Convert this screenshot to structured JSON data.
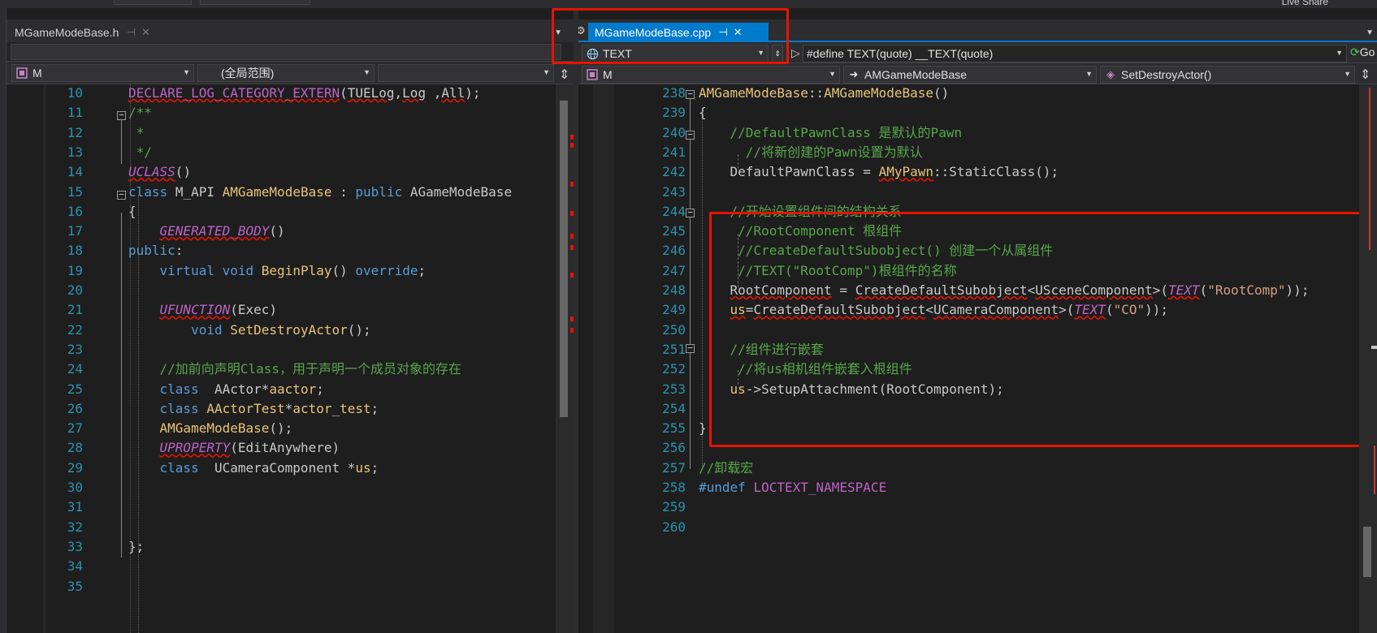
{
  "left_tab": {
    "label": "MGameModeBase.h",
    "pin": "⊣",
    "close": "✕"
  },
  "right_tab": {
    "label": "MGameModeBase.cpp",
    "pin": "⊣",
    "close": "✕"
  },
  "left_nav": {
    "project": "M",
    "scope": "(全局范围)",
    "member": ""
  },
  "right_macro_bar": {
    "symbol": "TEXT",
    "definition": "#define TEXT(quote) __TEXT(quote)",
    "go": "Go"
  },
  "right_nav": {
    "project": "M",
    "class": "AMGameModeBase",
    "member": "SetDestroyActor()"
  },
  "toolbar": {
    "live_share": "Live Share"
  },
  "left_code": [
    {
      "n": "10",
      "text": "DECLARE_LOG_CATEGORY_EXTERN(TUELog,Log ,All);"
    },
    {
      "n": "11",
      "text": "/**"
    },
    {
      "n": "12",
      "text": " *"
    },
    {
      "n": "13",
      "text": " */"
    },
    {
      "n": "14",
      "text": "UCLASS()"
    },
    {
      "n": "15",
      "text": "class M_API AMGameModeBase : public AGameModeBase"
    },
    {
      "n": "16",
      "text": "{"
    },
    {
      "n": "17",
      "text": "    GENERATED_BODY()"
    },
    {
      "n": "18",
      "text": "public:"
    },
    {
      "n": "19",
      "text": "    virtual void BeginPlay() override;"
    },
    {
      "n": "20",
      "text": ""
    },
    {
      "n": "21",
      "text": "    UFUNCTION(Exec)"
    },
    {
      "n": "22",
      "text": "        void SetDestroyActor();"
    },
    {
      "n": "23",
      "text": ""
    },
    {
      "n": "24",
      "text": "    //加前向声明Class，用于声明一个成员对象的存在"
    },
    {
      "n": "25",
      "text": "    class  AActor*aactor;"
    },
    {
      "n": "26",
      "text": "    class AActorTest*actor_test;"
    },
    {
      "n": "27",
      "text": "    AMGameModeBase();"
    },
    {
      "n": "28",
      "text": "    UPROPERTY(EditAnywhere)"
    },
    {
      "n": "29",
      "text": "    class  UCameraComponent *us;"
    },
    {
      "n": "30",
      "text": ""
    },
    {
      "n": "31",
      "text": ""
    },
    {
      "n": "32",
      "text": ""
    },
    {
      "n": "33",
      "text": "};"
    },
    {
      "n": "34",
      "text": ""
    },
    {
      "n": "35",
      "text": ""
    }
  ],
  "right_code": [
    {
      "n": "238",
      "text": "AMGameModeBase::AMGameModeBase()"
    },
    {
      "n": "239",
      "text": "{"
    },
    {
      "n": "240",
      "text": "    //DefaultPawnClass 是默认的Pawn"
    },
    {
      "n": "241",
      "text": "      //将新创建的Pawn设置为默认"
    },
    {
      "n": "242",
      "text": "    DefaultPawnClass = AMyPawn::StaticClass();"
    },
    {
      "n": "243",
      "text": ""
    },
    {
      "n": "244",
      "text": "    //开始设置组件间的结构关系"
    },
    {
      "n": "245",
      "text": "     //RootComponent 根组件"
    },
    {
      "n": "246",
      "text": "     //CreateDefaultSubobject() 创建一个从属组件"
    },
    {
      "n": "247",
      "text": "     //TEXT(\"RootComp\")根组件的名称"
    },
    {
      "n": "248",
      "text": "    RootComponent = CreateDefaultSubobject<USceneComponent>(TEXT(\"RootComp\"));"
    },
    {
      "n": "249",
      "text": "    us=CreateDefaultSubobject<UCameraComponent>(TEXT(\"CO\"));"
    },
    {
      "n": "250",
      "text": ""
    },
    {
      "n": "251",
      "text": "    //组件进行嵌套"
    },
    {
      "n": "252",
      "text": "     //将us相机组件嵌套入根组件"
    },
    {
      "n": "253",
      "text": "    us->SetupAttachment(RootComponent);"
    },
    {
      "n": "254",
      "text": ""
    },
    {
      "n": "255",
      "text": "}"
    },
    {
      "n": "256",
      "text": ""
    },
    {
      "n": "257",
      "text": "//卸载宏"
    },
    {
      "n": "258",
      "text": "#undef LOCTEXT_NAMESPACE"
    },
    {
      "n": "259",
      "text": ""
    },
    {
      "n": "260",
      "text": ""
    }
  ],
  "colors": {
    "keyword": "#569cd6",
    "type": "#e8c37a",
    "comment": "#57a64a",
    "macro": "#bd63c5",
    "string": "#d69d85",
    "line_number": "#2b91af",
    "accent": "#007acc",
    "highlight_box": "#e51400"
  }
}
